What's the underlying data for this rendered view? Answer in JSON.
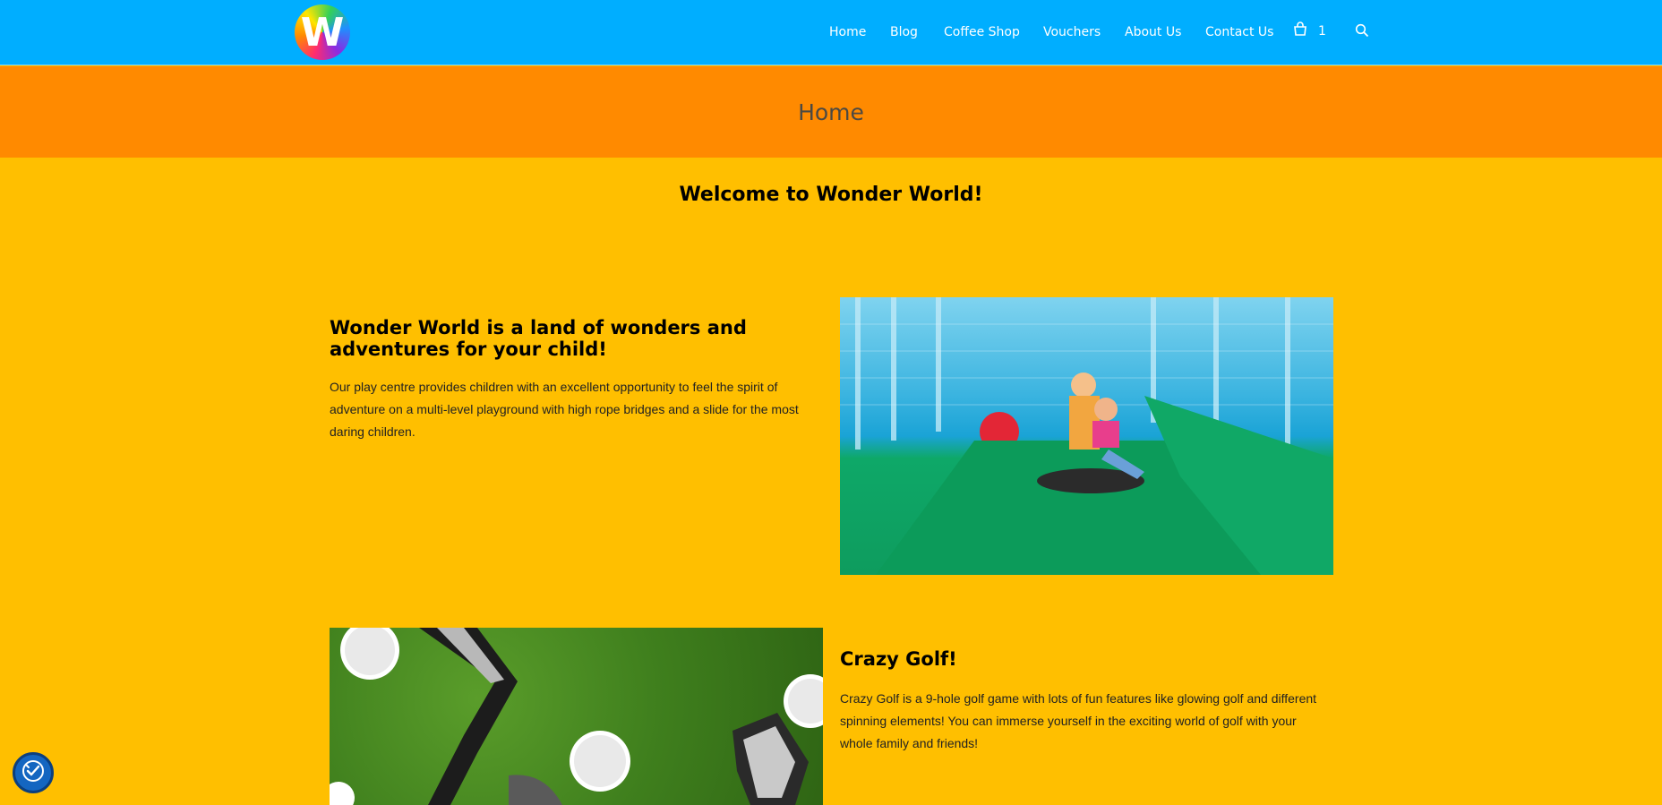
{
  "header": {
    "logo_letter": "W",
    "nav": [
      "Home",
      "Blog",
      "Coffee Shop",
      "Vouchers",
      "About Us",
      "Contact Us"
    ],
    "cart_count": "1",
    "icons": {
      "cart": "shopping-bag-icon",
      "search": "search-icon"
    }
  },
  "banner": {
    "title": "Home"
  },
  "welcome": "Welcome to Wonder World!",
  "sections": [
    {
      "heading": "Wonder World is a land of wonders and adventures for your child!",
      "text": "Our play centre provides children with an excellent opportunity to feel the spirit of adventure on a multi-level playground with high rope bridges and a slide for the most daring children."
    },
    {
      "heading": "Crazy Golf!",
      "text": "Crazy Golf is a 9-hole golf game with lots of fun features like glowing golf and different spinning elements! You can immerse yourself in the exciting world of golf with your whole family and friends!"
    }
  ],
  "colors": {
    "header_bg": "#00aeff",
    "banner_bg": "#ff8a00",
    "page_bg": "#ffbf00",
    "a11y_button": "#1466c1"
  },
  "accessibility_icon": "accessibility-check-icon"
}
